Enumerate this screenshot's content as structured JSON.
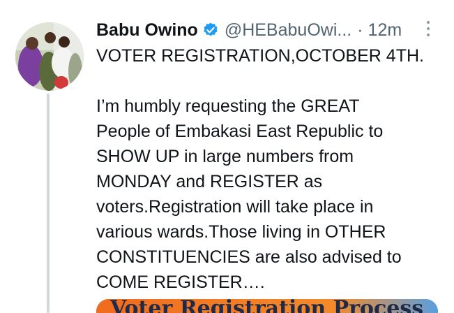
{
  "tweet": {
    "author_name": "Babu Owino",
    "handle": "@HEBabuOwi...",
    "separator": "·",
    "time": "12m",
    "lines": [
      "VOTER REGISTRATION,OCTOBER 4TH.",
      "",
      "I’m humbly requesting the GREAT",
      "People of Embakasi East Republic to",
      "SHOW UP in large numbers from",
      "MONDAY and REGISTER as",
      "voters.Registration will take place in",
      "various wards.Those living in OTHER",
      "CONSTITUENCIES are also advised to",
      "COME REGISTER…."
    ],
    "media_caption": "Voter Registration Process"
  },
  "colors": {
    "name": "#0f1419",
    "secondary": "#536471",
    "verified": "#1d9bf0",
    "thread_line": "#cfd9de"
  },
  "icons": {
    "verified": "verified-badge-icon",
    "more": "more-vertical-icon"
  }
}
